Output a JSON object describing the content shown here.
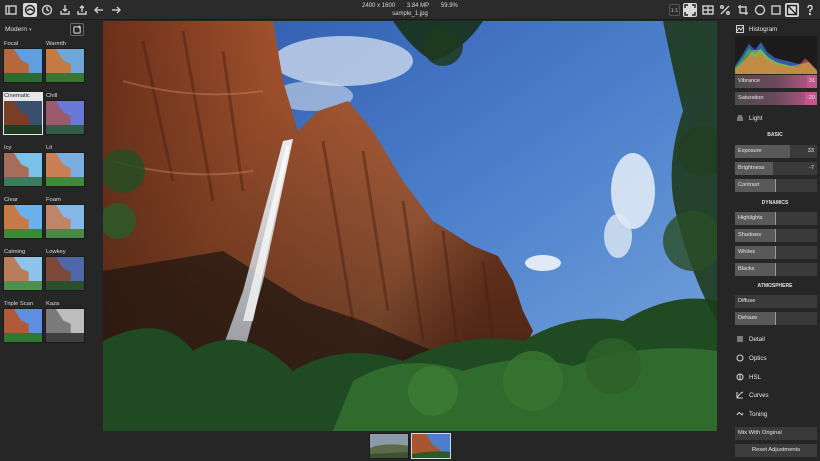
{
  "toolbar": {
    "left_icons": [
      "sidebar-toggle-icon",
      "presets-icon",
      "history-icon",
      "import-icon",
      "export-icon",
      "undo-icon",
      "redo-icon"
    ],
    "file": {
      "dimensions": "2400 x 1600",
      "megapixels": "3.84 MP",
      "zoom_percent": "59.9%",
      "filename": "sample_1.jpg"
    },
    "zoom_button_label": "1:1",
    "right_icons": [
      "fit-screen-icon",
      "compare-icon",
      "split-compare-icon",
      "crop-icon",
      "circle-icon",
      "square-icon",
      "filter-icon",
      "help-icon"
    ]
  },
  "presets": {
    "group_label": "Modern",
    "items": [
      {
        "label": "Focal",
        "selected": false
      },
      {
        "label": "Warmth",
        "selected": false
      },
      {
        "label": "Cinematic",
        "selected": true
      },
      {
        "label": "Chill",
        "selected": false
      },
      {
        "label": "Icy",
        "selected": false
      },
      {
        "label": "Lit",
        "selected": false
      },
      {
        "label": "Clear",
        "selected": false
      },
      {
        "label": "Foam",
        "selected": false
      },
      {
        "label": "Calming",
        "selected": false
      },
      {
        "label": "Lowkey",
        "selected": false
      },
      {
        "label": "Triple Scan",
        "selected": false
      },
      {
        "label": "Kaza",
        "selected": false
      }
    ]
  },
  "adjustments": {
    "histogram_label": "Histogram",
    "vibrance": {
      "label": "Vibrance",
      "value": "31"
    },
    "saturation": {
      "label": "Saturation",
      "value": "-20"
    },
    "light_label": "Light",
    "basic_label": "BASIC",
    "exposure": {
      "label": "Exposure",
      "value": "33"
    },
    "brightness": {
      "label": "Brightness",
      "value": "-7"
    },
    "contrast": {
      "label": "Contrast",
      "value": ""
    },
    "dynamics_label": "DYNAMICS",
    "highlights": {
      "label": "Highlights",
      "value": ""
    },
    "shadows": {
      "label": "Shadows",
      "value": ""
    },
    "whites": {
      "label": "Whites",
      "value": ""
    },
    "blacks": {
      "label": "Blacks",
      "value": ""
    },
    "atmosphere_label": "ATMOSPHERE",
    "diffuse": {
      "label": "Diffuse",
      "value": ""
    },
    "dehaze": {
      "label": "Dehaze",
      "value": ""
    },
    "sections": [
      {
        "label": "Detail",
        "icon": "detail-lines-icon"
      },
      {
        "label": "Optics",
        "icon": "optics-circle-icon"
      },
      {
        "label": "HSL",
        "icon": "hsl-icon"
      },
      {
        "label": "Curves",
        "icon": "curves-icon"
      },
      {
        "label": "Toning",
        "icon": "toning-icon"
      }
    ],
    "mix_label": "Mix With Original",
    "reset_label": "Reset Adjustments"
  },
  "colors": {
    "accent_pink": "#c2578e",
    "panel_bg": "#262626"
  }
}
